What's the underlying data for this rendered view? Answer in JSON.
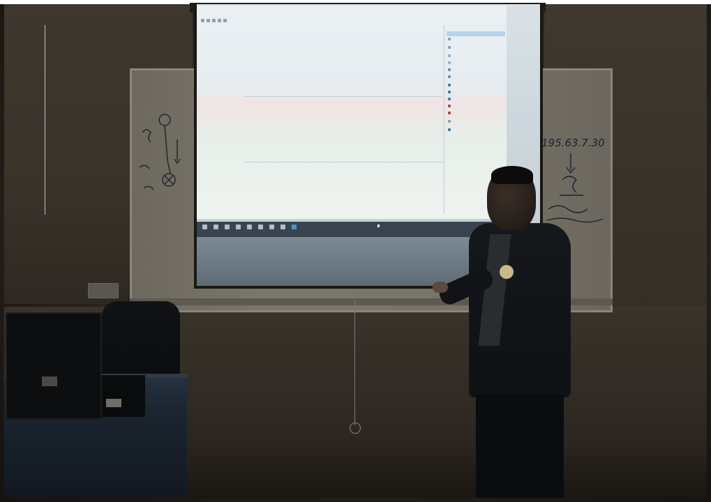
{
  "scene": {
    "description_tag": "presentation",
    "screen_window": {
      "title": "",
      "menu": [
        "",
        "",
        "",
        ""
      ],
      "tree": [
        "",
        ""
      ],
      "sections": [
        {
          "title": "",
          "empty_message": ""
        },
        {
          "title": "",
          "empty_message": ""
        },
        {
          "title": "",
          "empty_message": ""
        }
      ],
      "columns": [
        "",
        "",
        "",
        "",
        "",
        "",
        ""
      ],
      "actions_title": "",
      "actions": [
        "",
        "",
        "",
        "",
        "",
        "",
        "",
        "",
        "",
        "",
        "",
        "",
        "",
        "",
        "",
        "",
        "",
        ""
      ],
      "statusbar": "",
      "tray_text": "",
      "clock_time": "",
      "clock_date": ""
    },
    "whiteboard_left_notes": [
      "",
      "",
      "",
      ""
    ],
    "whiteboard_right_notes": [
      "195.63.7.30",
      "",
      "",
      ""
    ]
  },
  "colors": {
    "screen": "#cdd8de",
    "taskbar": "#3a4450",
    "active_taskbar_icon": "#4aa3df",
    "whiteboard": "#777367"
  }
}
